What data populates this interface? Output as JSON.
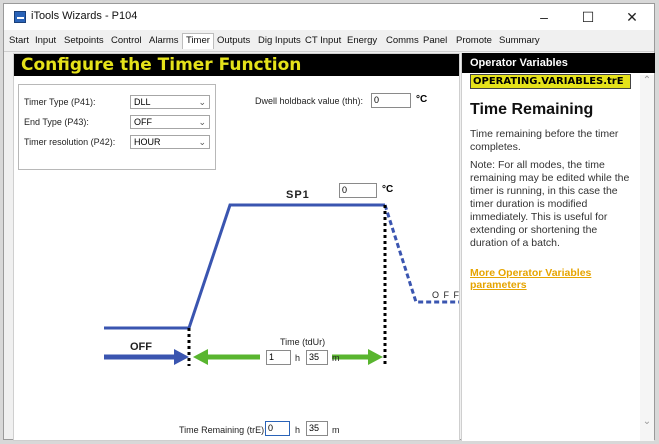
{
  "window": {
    "title": "iTools Wizards - P104",
    "minimize": "–",
    "maximize": "☐",
    "close": "✕"
  },
  "tabs": [
    "Start",
    "Input",
    "Setpoints",
    "Control",
    "Alarms",
    "Timer",
    "Outputs",
    "Dig Inputs",
    "CT Input",
    "Energy",
    "Comms",
    "Panel",
    "Promote",
    "Summary"
  ],
  "active_tab": "Timer",
  "banner": "Configure the Timer Function",
  "form": {
    "timer_type_label": "Timer Type (P41):",
    "timer_type_value": "DLL",
    "end_type_label": "End Type (P43):",
    "end_type_value": "OFF",
    "resolution_label": "Timer resolution (P42):",
    "resolution_value": "HOUR",
    "dwell_label": "Dwell holdback value (thh):",
    "dwell_value": "0",
    "dwell_unit": "°C"
  },
  "diagram": {
    "sp_label": "SP1",
    "sp_value": "0",
    "sp_unit": "°C",
    "off_label": "OFF",
    "off_right_label": "O F F",
    "time_label": "Time (tdUr)",
    "time_h": "1",
    "time_h_unit": "h",
    "time_m": "35",
    "time_m_unit": "m",
    "remaining_label": "Time Remaining (trE):",
    "remaining_h": "0",
    "remaining_h_unit": "h",
    "remaining_m": "35",
    "remaining_m_unit": "m"
  },
  "help": {
    "header": "Operator Variables",
    "variable": "OPERATING.VARIABLES.trE",
    "title": "Time Remaining",
    "desc": "Time remaining before the timer completes.",
    "note": "Note: For all modes, the time remaining may be edited while the timer is running, in this case the timer duration is modified immediately. This is useful for extending or shortening the duration of a batch.",
    "link": "More Operator Variables parameters"
  },
  "colors": {
    "banner_bg": "#000000",
    "banner_text": "#e5e21a",
    "profile_line": "#3a55b0",
    "arrow_green": "#59b52f",
    "link": "#e6a400"
  },
  "icons": {
    "app": "itools-app-icon",
    "scroll_up": "chevron-up-icon",
    "scroll_down": "chevron-down-icon",
    "select": "chevron-down-icon"
  }
}
